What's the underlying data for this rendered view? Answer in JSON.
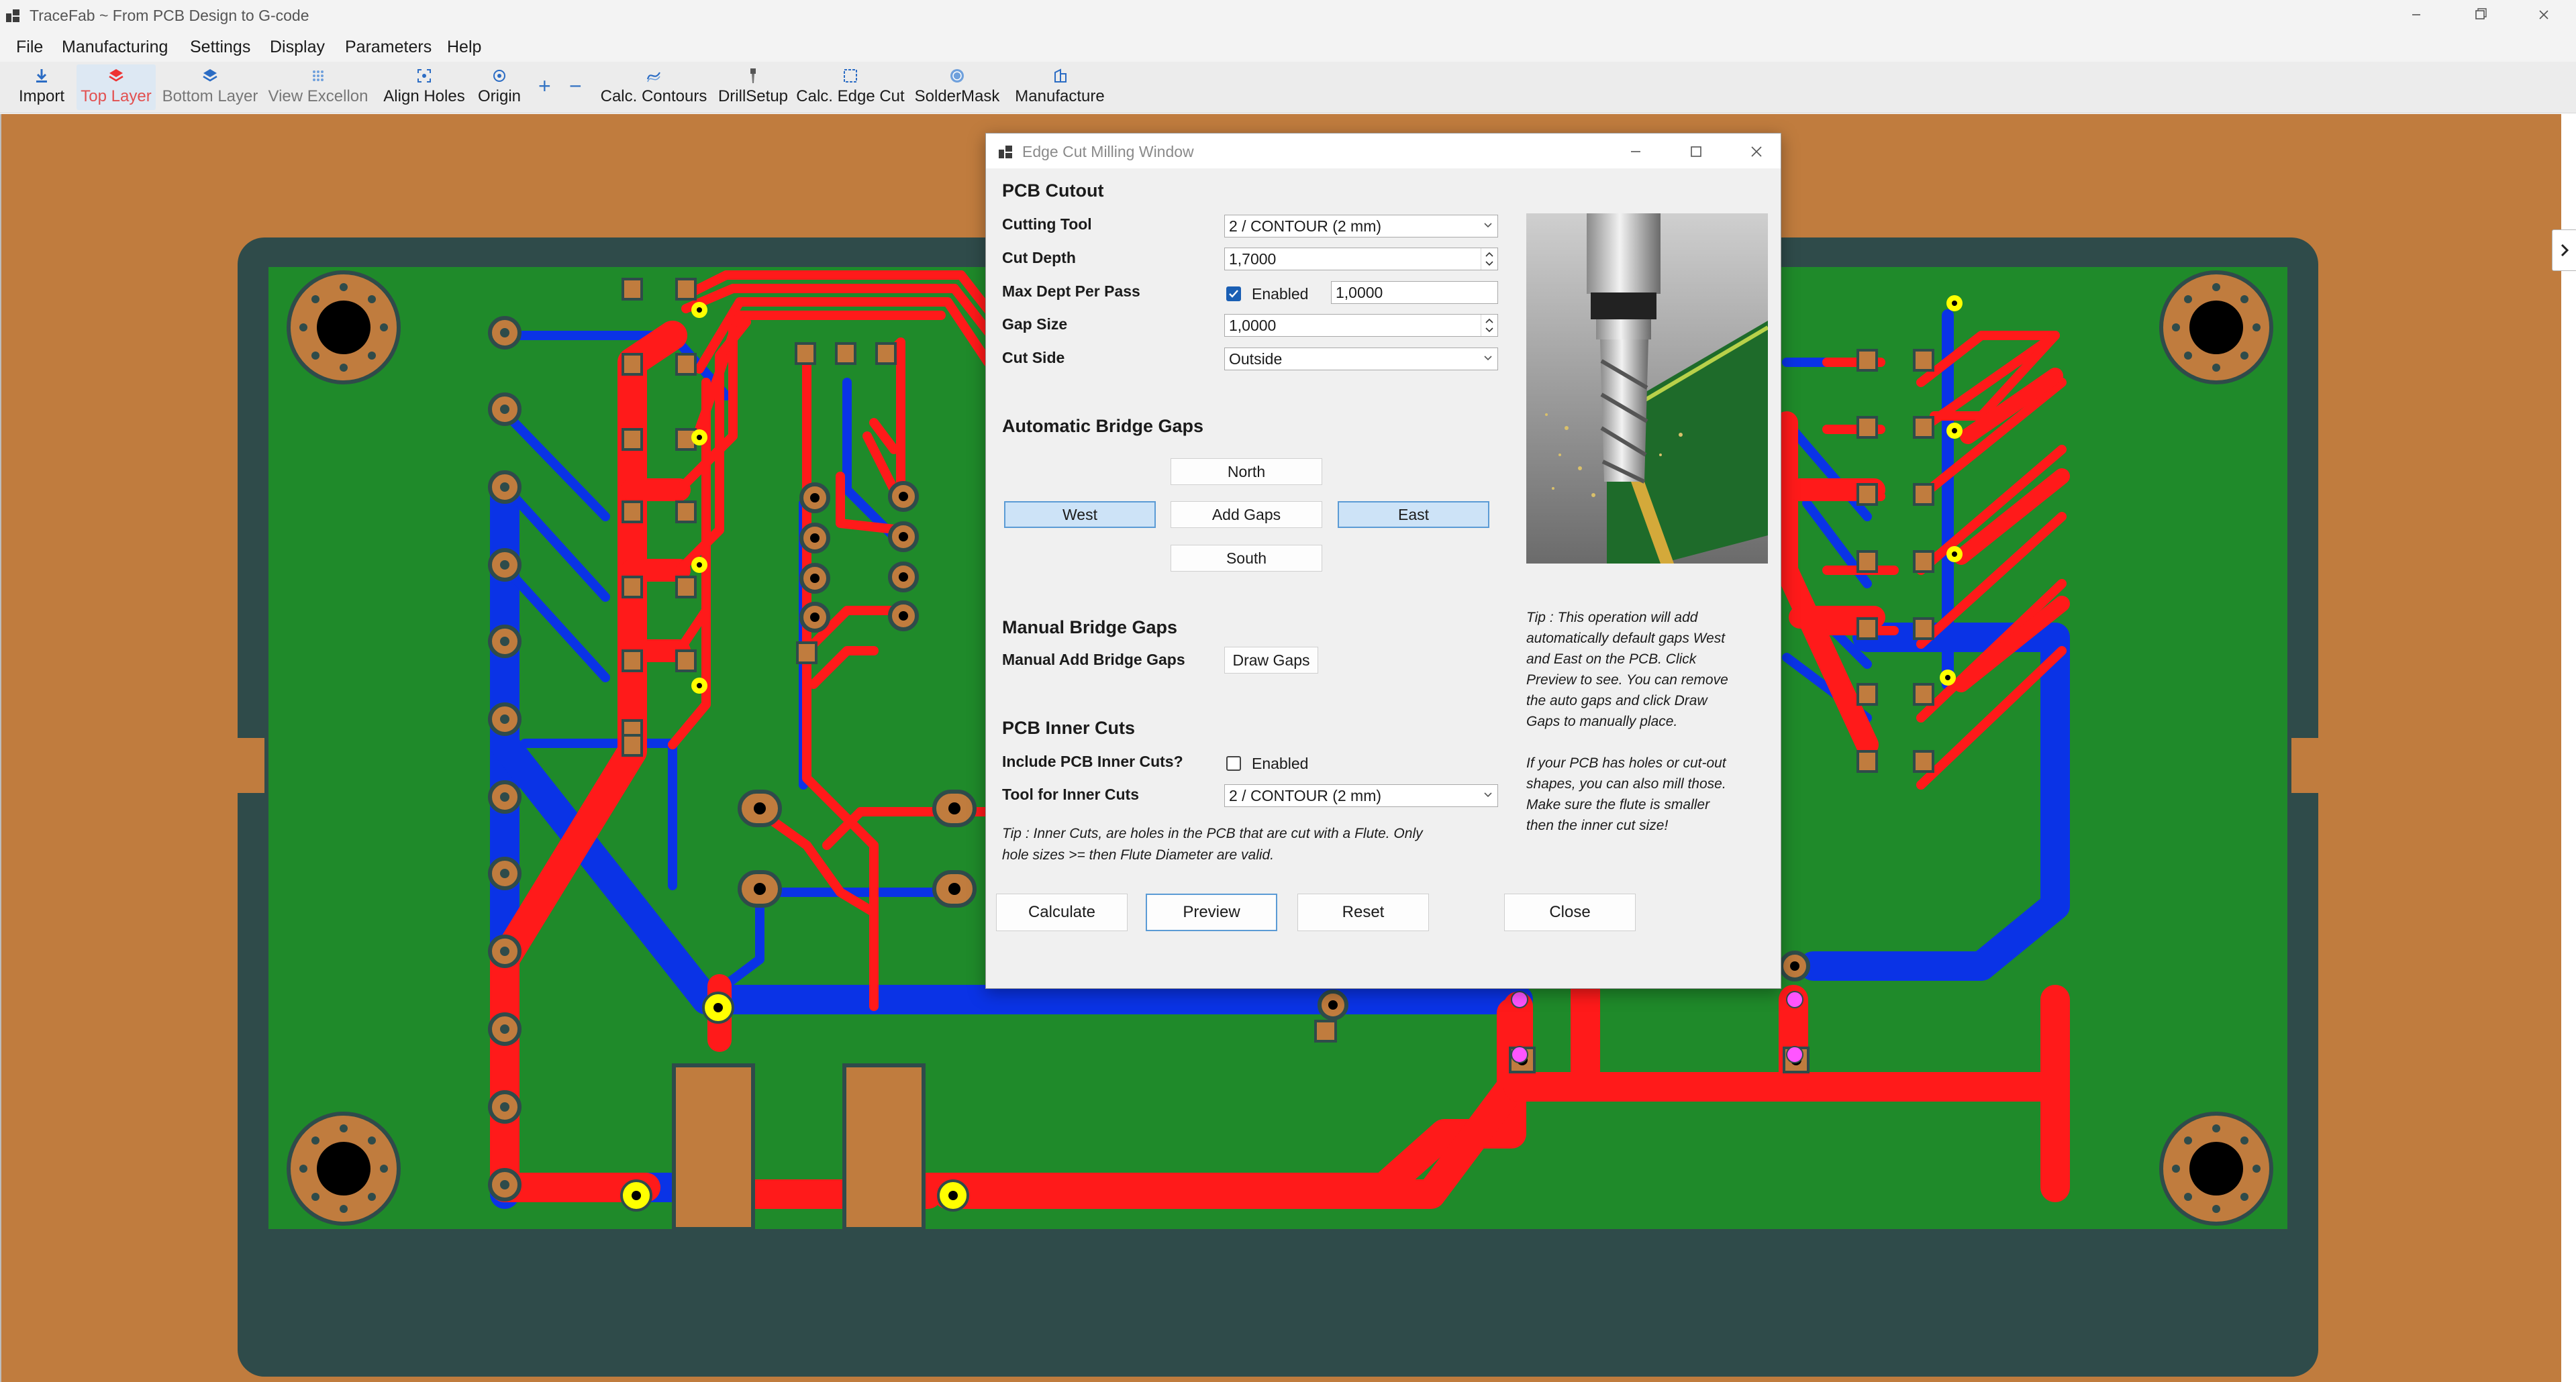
{
  "window": {
    "title": "TraceFab ~ From PCB Design to G-code",
    "icons": [
      "app-icon",
      "minimize-icon",
      "maximize-icon",
      "close-icon"
    ]
  },
  "menu": {
    "file": "File",
    "manufacturing": "Manufacturing",
    "settings": "Settings",
    "display": "Display",
    "parameters": "Parameters",
    "help": "Help"
  },
  "toolbar": {
    "import": "Import",
    "top_layer": "Top Layer",
    "bottom_layer": "Bottom Layer",
    "view_excellon": "View Excellon",
    "align_holes": "Align Holes",
    "origin": "Origin",
    "zoom_in": "+",
    "zoom_out": "−",
    "calc_contours": "Calc. Contours",
    "drill_setup": "DrillSetup",
    "calc_edge_cut": "Calc. Edge Cut",
    "soldermask": "SolderMask",
    "manufacture": "Manufacture"
  },
  "colors": {
    "board_bg": "#c07c3e",
    "pcb_green": "#1f8a2a",
    "pcb_border": "#2f4b4a",
    "trace_red": "#ff1a1a",
    "trace_blue": "#0a33e6",
    "pad_copper": "#c07c3e",
    "via_yellow": "#ffff00",
    "accent": "#1a5fb4"
  },
  "dialog": {
    "title": "Edge Cut Milling Window",
    "pcb_cutout": {
      "heading": "PCB Cutout",
      "cutting_tool_label": "Cutting Tool",
      "cutting_tool_value": "2 / CONTOUR (2 mm)",
      "cut_depth_label": "Cut Depth",
      "cut_depth_value": "1,7000",
      "max_depth_label": "Max Dept Per Pass",
      "max_depth_enabled_label": "Enabled",
      "max_depth_enabled": true,
      "max_depth_value": "1,0000",
      "gap_size_label": "Gap Size",
      "gap_size_value": "1,0000",
      "cut_side_label": "Cut Side",
      "cut_side_value": "Outside"
    },
    "auto_gaps": {
      "heading": "Automatic Bridge Gaps",
      "north": "North",
      "west": "West",
      "add": "Add Gaps",
      "east": "East",
      "south": "South"
    },
    "manual_gaps": {
      "heading": "Manual Bridge Gaps",
      "label": "Manual Add Bridge Gaps",
      "button": "Draw Gaps"
    },
    "inner_cuts": {
      "heading": "PCB Inner Cuts",
      "include_label": "Include PCB Inner Cuts?",
      "enabled_label": "Enabled",
      "enabled": false,
      "tool_label": "Tool for Inner Cuts",
      "tool_value": "2 / CONTOUR (2 mm)",
      "tip_line1": "Tip : Inner Cuts, are holes in the PCB that are cut with a Flute. Only",
      "tip_line2": "hole sizes >= then Flute Diameter are valid."
    },
    "tip_lines": [
      "Tip : This operation will add",
      "automatically default gaps West",
      "and East on the PCB. Click",
      "Preview to see. You can remove",
      "the auto gaps and click Draw",
      "Gaps to manually place.",
      "",
      "If your PCB has holes or cut-out",
      "shapes, you can also mill those.",
      "Make sure the flute is smaller",
      "then the inner cut size!"
    ],
    "buttons": {
      "calculate": "Calculate",
      "preview": "Preview",
      "reset": "Reset",
      "close": "Close"
    }
  }
}
